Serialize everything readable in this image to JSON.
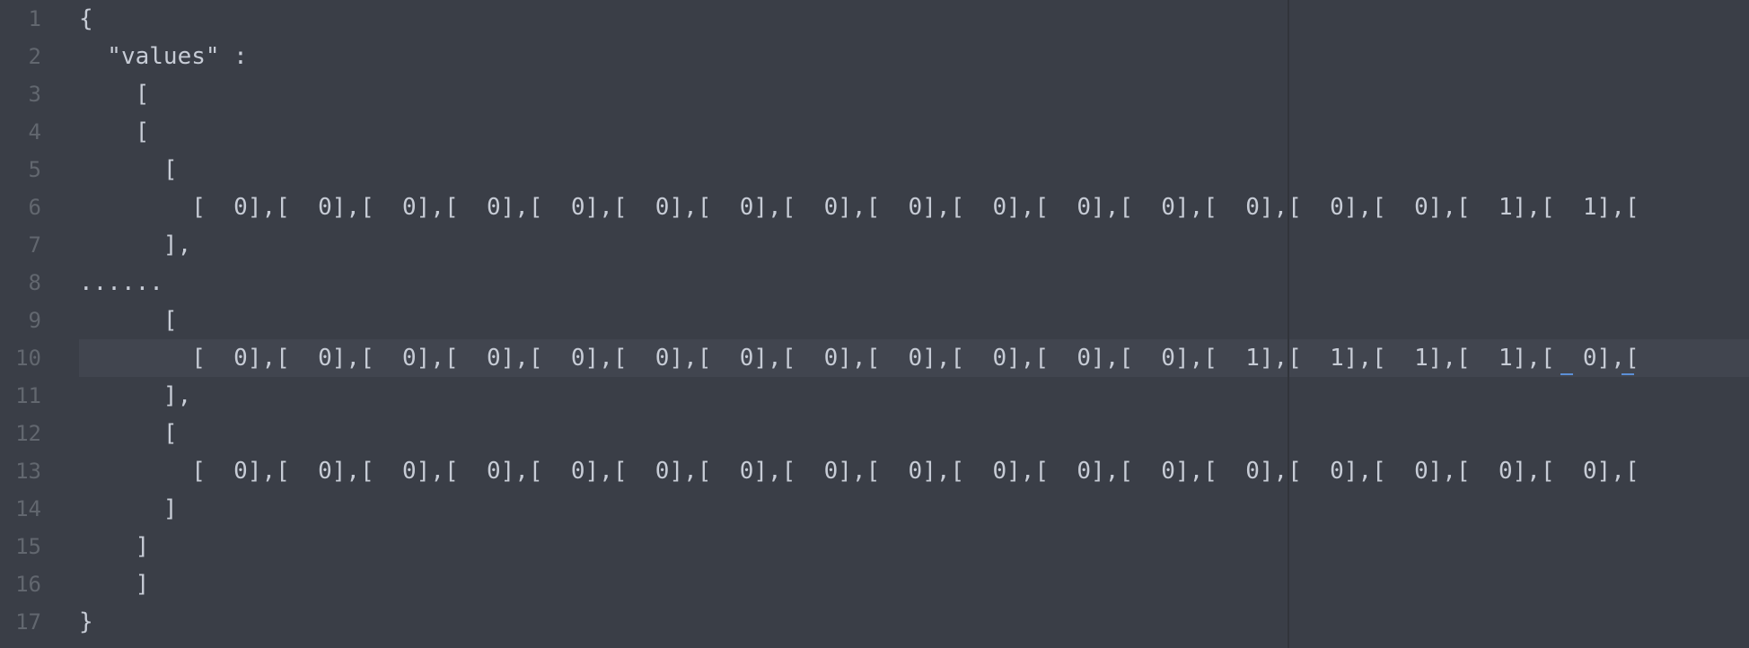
{
  "lines": [
    {
      "num": "1",
      "text": "{"
    },
    {
      "num": "2",
      "text": "  \"values\" :"
    },
    {
      "num": "3",
      "text": "    ["
    },
    {
      "num": "4",
      "text": "    ["
    },
    {
      "num": "5",
      "text": "      ["
    },
    {
      "num": "6",
      "text": "        [  0],[  0],[  0],[  0],[  0],[  0],[  0],[  0],[  0],[  0],[  0],[  0],[  0],[  0],[  0],[  1],[  1],["
    },
    {
      "num": "7",
      "text": "      ],"
    },
    {
      "num": "8",
      "text": "......"
    },
    {
      "num": "9",
      "text": "      ["
    },
    {
      "num": "10",
      "text": "        [  0],[  0],[  0],[  0],[  0],[  0],[  0],[  0],[  0],[  0],[  0],[  0],[  1],[  1],[  1],[  1],[  0],["
    },
    {
      "num": "11",
      "text": "      ],"
    },
    {
      "num": "12",
      "text": "      ["
    },
    {
      "num": "13",
      "text": "        [  0],[  0],[  0],[  0],[  0],[  0],[  0],[  0],[  0],[  0],[  0],[  0],[  0],[  0],[  0],[  0],[  0],["
    },
    {
      "num": "14",
      "text": "      ]"
    },
    {
      "num": "15",
      "text": "    ]"
    },
    {
      "num": "16",
      "text": "    ]"
    },
    {
      "num": "17",
      "text": "}"
    }
  ],
  "current_line": "10"
}
